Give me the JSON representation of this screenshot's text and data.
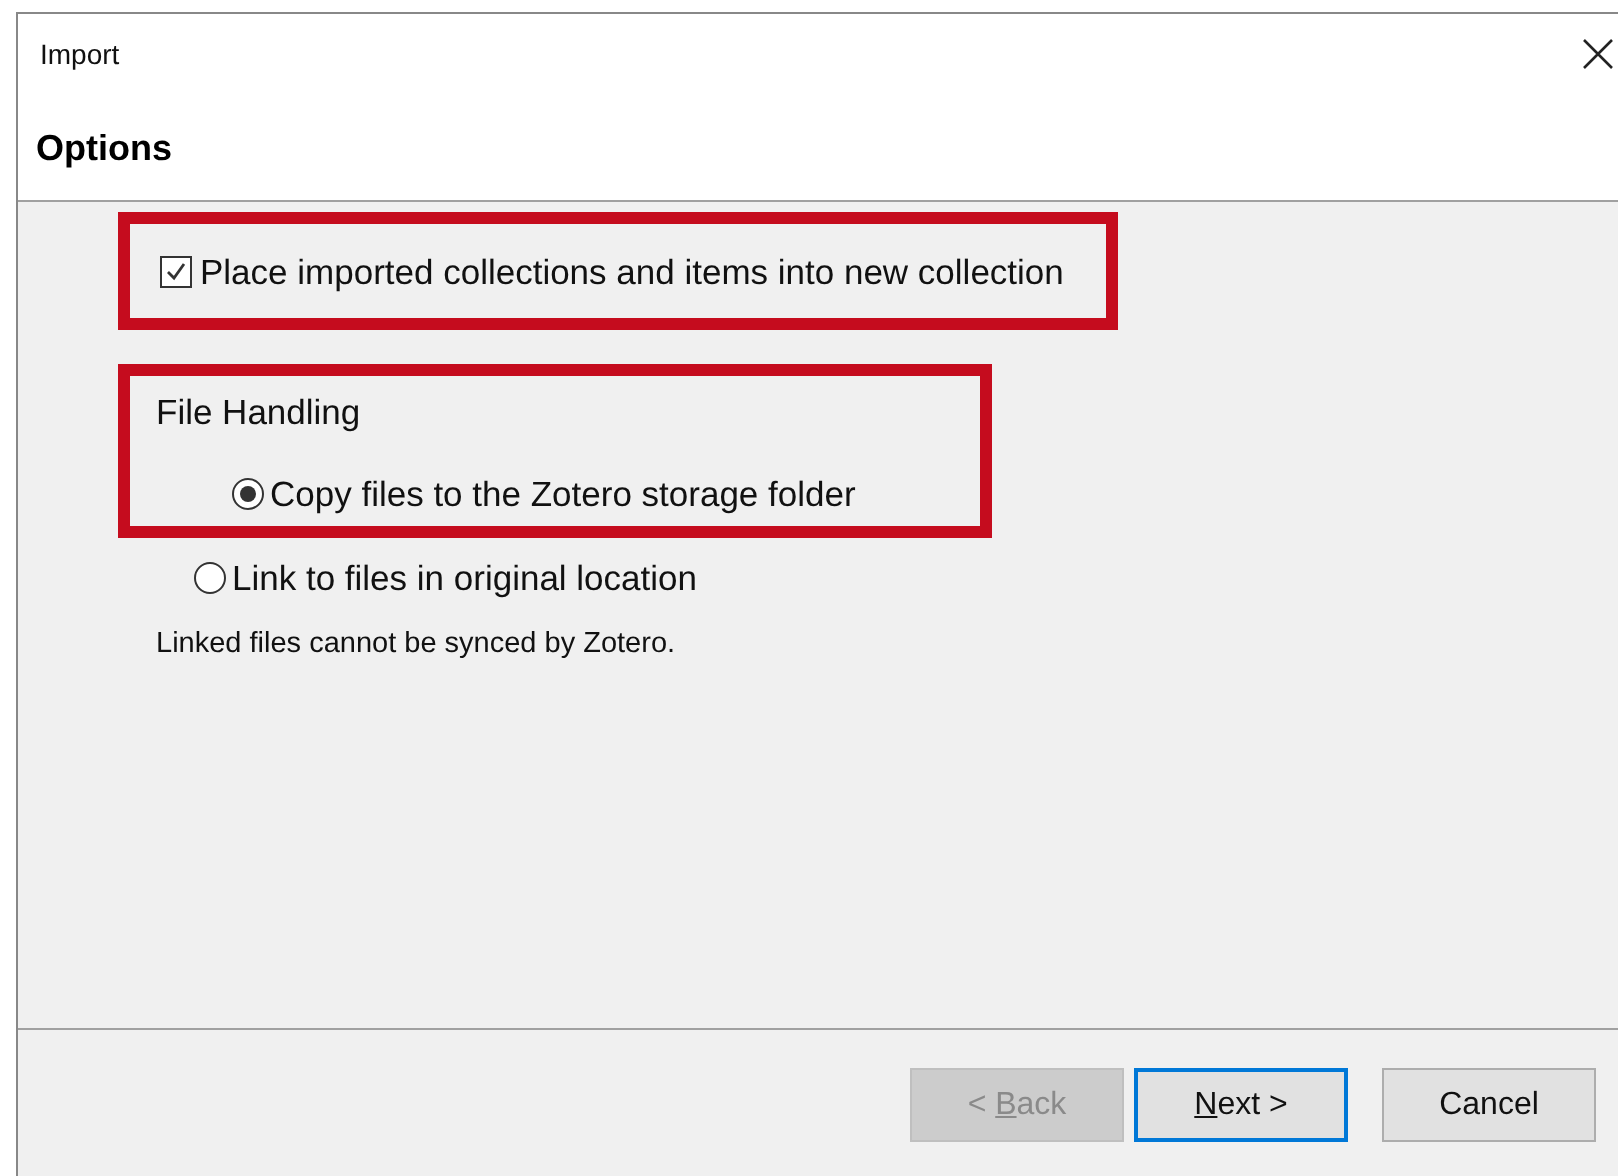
{
  "window": {
    "title": "Import"
  },
  "header": {
    "title": "Options"
  },
  "collection_option": {
    "label": "Place imported collections and items into new collection",
    "checked": true,
    "highlighted": true
  },
  "file_handling": {
    "heading": "File Handling",
    "highlighted": true,
    "options": [
      {
        "label": "Copy files to the Zotero storage folder",
        "selected": true,
        "highlighted": true
      },
      {
        "label": "Link to files in original location",
        "selected": false,
        "highlighted": false
      }
    ],
    "note": "Linked files cannot be synced by Zotero."
  },
  "buttons": [
    {
      "kind": "back",
      "before": "< ",
      "mnemonic": "B",
      "after": "ack",
      "disabled": true,
      "focused": false
    },
    {
      "kind": "next",
      "mnemonic": "N",
      "after": "ext >",
      "disabled": false,
      "focused": true
    },
    {
      "kind": "cancel",
      "before": "Cancel",
      "disabled": false,
      "focused": false
    }
  ]
}
